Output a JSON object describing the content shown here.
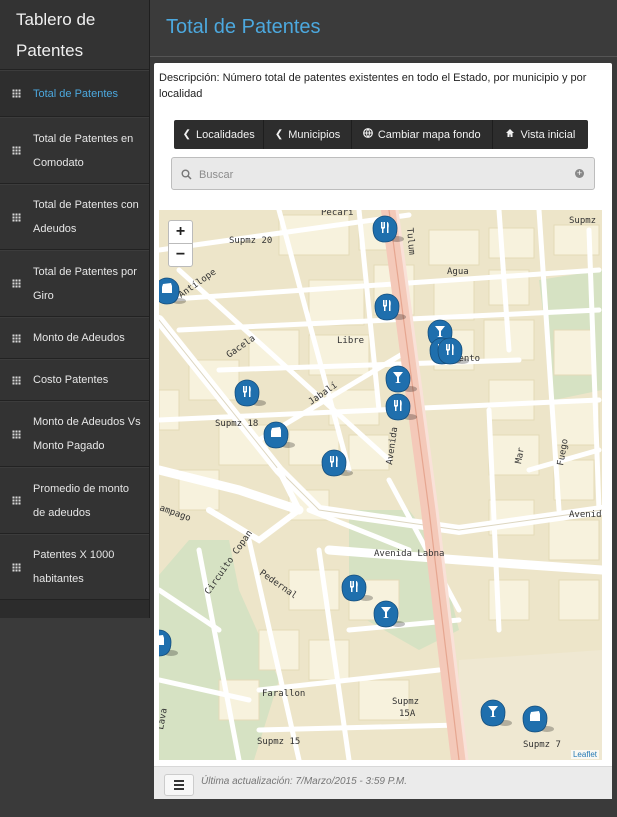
{
  "sidebar": {
    "title_line1": "Tablero de",
    "title_line2": "Patentes",
    "items": [
      {
        "label": "Total de Patentes"
      },
      {
        "label": "Total de Patentes en Comodato"
      },
      {
        "label": "Total de Patentes con Adeudos"
      },
      {
        "label": "Total de Patentes por Giro"
      },
      {
        "label": "Monto de Adeudos"
      },
      {
        "label": "Costo Patentes"
      },
      {
        "label": "Monto de Adeudos Vs Monto Pagado"
      },
      {
        "label": "Promedio de monto de adeudos"
      },
      {
        "label": "Patentes X 1000 habitantes"
      }
    ],
    "active_index": 0
  },
  "header": {
    "title": "Total de Patentes"
  },
  "panel": {
    "description": "Descripción: Número total de patentes existentes en todo el Estado, por municipio y por localidad"
  },
  "toolbar": {
    "localidades": "Localidades",
    "municipios": "Municipios",
    "cambiar_mapa": "Cambiar mapa fondo",
    "vista_inicial": "Vista inicial"
  },
  "search": {
    "placeholder": "Buscar"
  },
  "map": {
    "zoom_in": "+",
    "zoom_out": "−",
    "attribution": "Leaflet",
    "streets": {
      "pecari": "Pecarí",
      "supmz20": "Supmz 20",
      "supmz_top_right": "Supmz",
      "tulum": "Tulum",
      "agua": "Agua",
      "antilope": "Antílope",
      "gacela": "Gacela",
      "libre": "Libre",
      "jabali": "Jabalí",
      "supmz18": "Supmz 18",
      "avenida_right": "Avenida",
      "mar": "Mar",
      "fuego": "Fuego",
      "viento": "iento",
      "campago": "ampago",
      "circuito_copan": "Circuito Copan",
      "avenida_labna": "Avenida Labna",
      "pedernal": "Pedernal",
      "avenida_vertical": "Avenida",
      "avenida_h": "Avenida",
      "farallon": "Farallon",
      "lava": "Lava",
      "supmz15a_1": "Supmz",
      "supmz15a_2": "15A",
      "supmz15": "Supmz 15",
      "supmz7": "Supmz 7"
    },
    "colors": {
      "land": "#ede5c9",
      "block": "#f6f1dc",
      "street": "#ffffff",
      "avenue": "#f3c7b8",
      "park": "#d7e3c4",
      "marker": "#1f6fad"
    },
    "markers": [
      {
        "icon": "fork-knife-icon"
      },
      {
        "icon": "store-icon"
      },
      {
        "icon": "fork-knife-icon"
      },
      {
        "icon": "cocktail-icon"
      },
      {
        "icon": "fork-knife-icon"
      },
      {
        "icon": "fork-knife-icon"
      },
      {
        "icon": "cocktail-icon"
      },
      {
        "icon": "fork-knife-icon"
      },
      {
        "icon": "fork-knife-icon"
      },
      {
        "icon": "store-icon"
      },
      {
        "icon": "fork-knife-icon"
      },
      {
        "icon": "fork-knife-icon"
      },
      {
        "icon": "cocktail-icon"
      },
      {
        "icon": "store-icon"
      },
      {
        "icon": "cocktail-icon"
      },
      {
        "icon": "store-icon"
      }
    ]
  },
  "footer": {
    "updated": "Última actualización: 7/Marzo/2015 - 3:59 P.M."
  }
}
